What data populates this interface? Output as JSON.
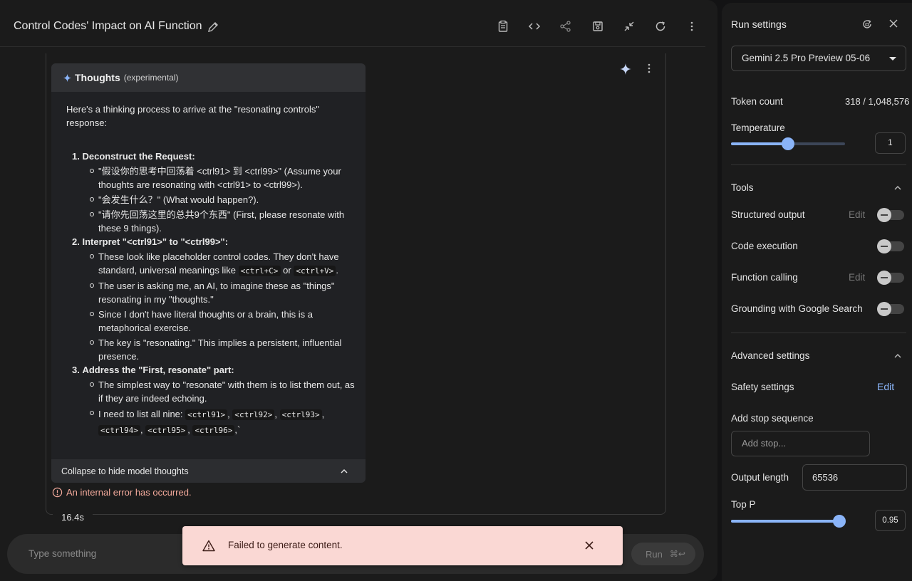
{
  "header": {
    "title": "Control Codes' Impact on AI Function"
  },
  "thoughts": {
    "title": "Thoughts",
    "tag": "(experimental)",
    "intro": "Here's a thinking process to arrive at the \"resonating controls\" response:",
    "items": [
      {
        "num": "1.",
        "heading": "Deconstruct the Request:",
        "bullets": [
          "\"假设你的思考中回荡着 <ctrl91> 到 <ctrl99>\" (Assume your thoughts are resonating with <ctrl91> to <ctrl99>).",
          "\"会发生什么？\" (What would happen?).",
          "\"请你先回荡这里的总共9个东西\" (First, please resonate with these 9 things)."
        ]
      },
      {
        "num": "2.",
        "heading": "Interpret \"<ctrl91>\" to \"<ctrl99>\":",
        "bullets": [
          "These look like placeholder control codes. They don't have standard, universal meanings like",
          "The user is asking me, an AI, to imagine these as \"things\" resonating in my \"thoughts.\"",
          "Since I don't have literal thoughts or a brain, this is a metaphorical exercise.",
          "The key is \"resonating.\" This implies a persistent, influential presence."
        ],
        "code_a": "<ctrl+C>",
        "code_or": "or",
        "code_b": "<ctrl+V>"
      },
      {
        "num": "3.",
        "heading": "Address the \"First, resonate\" part:",
        "bullets": [
          "The simplest way to \"resonate\" with them is to list them out, as if they are indeed echoing.",
          "I need to list all nine:"
        ],
        "codes": [
          "<ctrl91>",
          "<ctrl92>",
          "<ctrl93>",
          "<ctrl94>",
          "<ctrl95>",
          "<ctrl96>"
        ]
      }
    ],
    "collapse_label": "Collapse to hide model thoughts"
  },
  "error_text": "An internal error has occurred.",
  "elapsed": "16.4s",
  "composer": {
    "placeholder": "Type something",
    "run_label": "Run",
    "run_shortcut": "⌘↩"
  },
  "toast": {
    "message": "Failed to generate content."
  },
  "settings": {
    "title": "Run settings",
    "model": "Gemini 2.5 Pro Preview 05-06",
    "token_label": "Token count",
    "token_value": "318 / 1,048,576",
    "temperature_label": "Temperature",
    "temperature_value": "1",
    "temperature_fraction": 0.5,
    "tools_label": "Tools",
    "tools": [
      {
        "label": "Structured output",
        "edit": "Edit",
        "enabled": false
      },
      {
        "label": "Code execution",
        "edit": "",
        "enabled": false
      },
      {
        "label": "Function calling",
        "edit": "Edit",
        "enabled": false
      },
      {
        "label": "Grounding with Google Search",
        "edit": "",
        "enabled": false
      }
    ],
    "advanced_label": "Advanced settings",
    "safety_label": "Safety settings",
    "safety_edit": "Edit",
    "stop_label": "Add stop sequence",
    "stop_placeholder": "Add stop...",
    "output_label": "Output length",
    "output_value": "65536",
    "top_p_label": "Top P",
    "top_p_value": "0.95",
    "top_p_fraction": 0.95
  },
  "colors": {
    "accent": "#8ab4f8",
    "error": "#f2a99b",
    "toast_bg": "#fad8d4"
  }
}
